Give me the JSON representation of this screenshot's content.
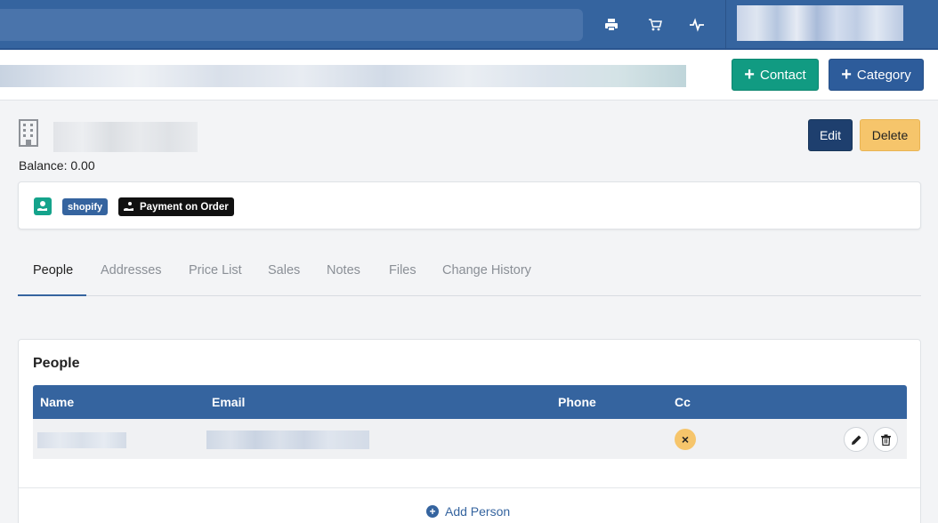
{
  "header": {
    "print_icon": "print-icon",
    "cart_icon": "cart-icon",
    "activity_icon": "activity-icon"
  },
  "actions": {
    "contact_label": "Contact",
    "category_label": "Category"
  },
  "company": {
    "balance_label": "Balance: 0.00",
    "edit_label": "Edit",
    "delete_label": "Delete"
  },
  "tags": {
    "shopify": "shopify",
    "payment": "Payment on Order"
  },
  "tabs": [
    {
      "label": "People"
    },
    {
      "label": "Addresses"
    },
    {
      "label": "Price List"
    },
    {
      "label": "Sales"
    },
    {
      "label": "Notes"
    },
    {
      "label": "Files"
    },
    {
      "label": "Change History"
    }
  ],
  "people": {
    "title": "People",
    "columns": [
      "Name",
      "Email",
      "Phone",
      "Cc"
    ],
    "rows": [
      {
        "cc": "×"
      }
    ],
    "add_label": "Add Person"
  },
  "colors": {
    "primary": "#35649f",
    "success": "#119b82",
    "warning": "#f6c56b",
    "dark": "#1e3f6e"
  }
}
